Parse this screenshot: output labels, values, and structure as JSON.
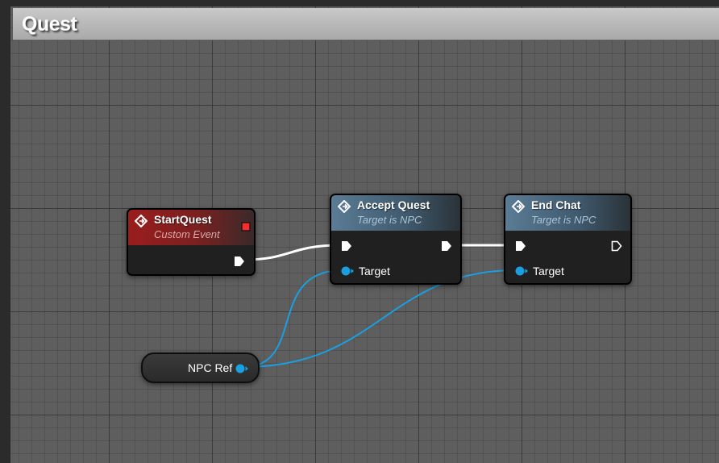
{
  "graph": {
    "title": "Quest"
  },
  "colors": {
    "exec_wire": "#ffffff",
    "object_wire": "#1a9fe0",
    "event_header": "#9a1d1d",
    "function_header": "#5a7c95"
  },
  "nodes": {
    "start_quest": {
      "title": "StartQuest",
      "subtitle": "Custom Event"
    },
    "accept_quest": {
      "title": "Accept Quest",
      "subtitle": "Target is NPC",
      "target_label": "Target"
    },
    "end_chat": {
      "title": "End Chat",
      "subtitle": "Target is NPC",
      "target_label": "Target"
    },
    "npc_ref": {
      "label": "NPC Ref"
    }
  }
}
